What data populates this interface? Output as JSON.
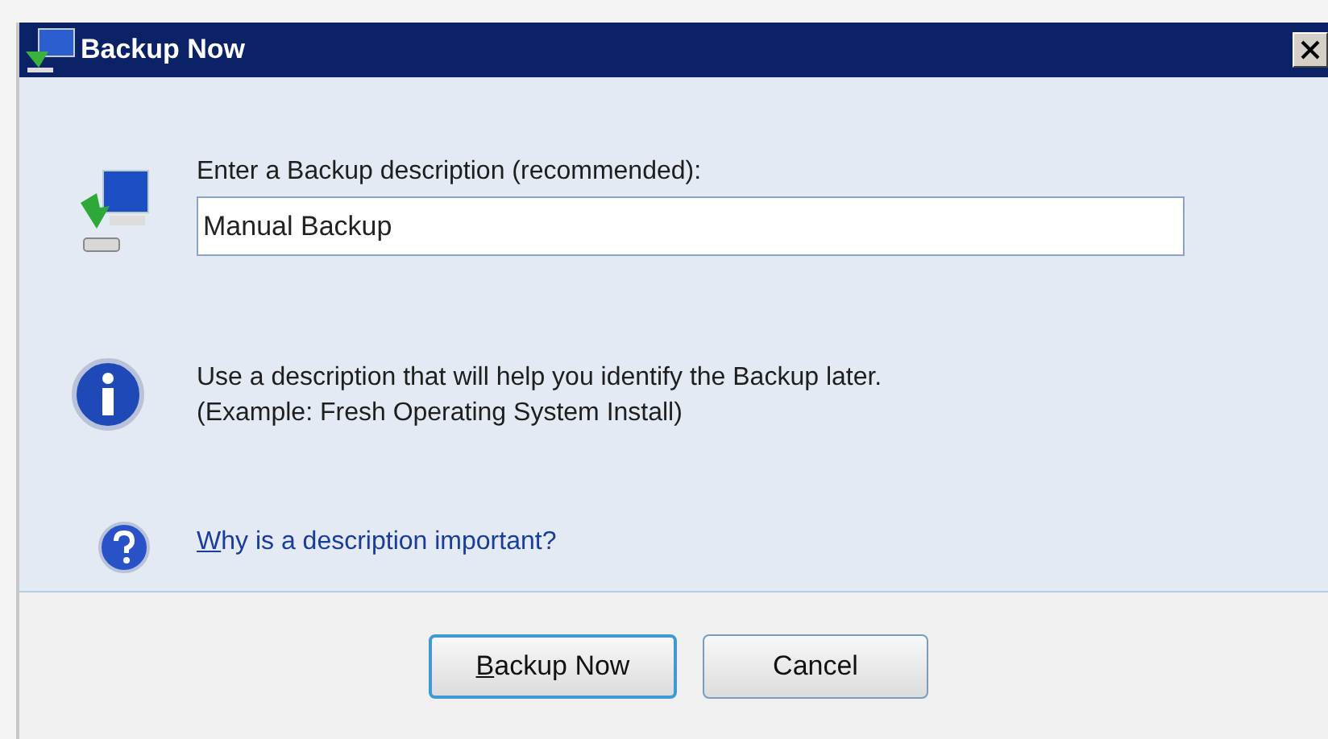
{
  "window": {
    "title": "Backup Now"
  },
  "description": {
    "label": "Enter a Backup description (recommended):",
    "value": "Manual Backup "
  },
  "info": {
    "lines": [
      "Use a description that will help you identify the Backup later.",
      "(Example: Fresh Operating System Install)"
    ]
  },
  "help_link": "Why is a description important?",
  "buttons": [
    {
      "label": "Backup Now",
      "default": true
    },
    {
      "label": "Cancel",
      "default": false
    }
  ]
}
